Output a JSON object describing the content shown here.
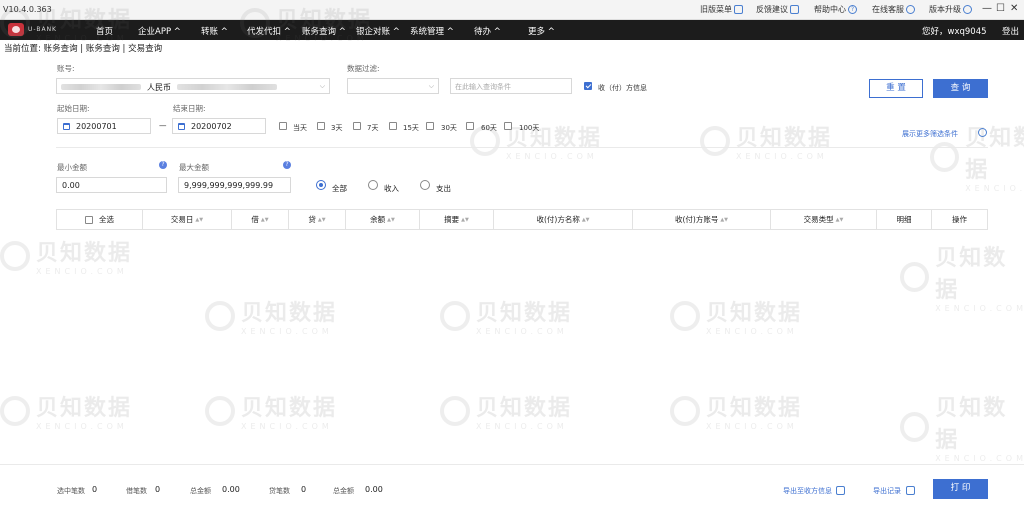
{
  "titlebar": {
    "version": "V10.4.0.363",
    "items": [
      {
        "label": "旧版菜单"
      },
      {
        "label": "反馈建议"
      },
      {
        "label": "帮助中心"
      },
      {
        "label": "在线客服"
      },
      {
        "label": "版本升级"
      }
    ],
    "minimize": "—",
    "maximize": "☐",
    "close": "✕"
  },
  "navbar": {
    "logo_text": "U-BANK",
    "items": [
      "首页",
      "企业APP ^",
      "转账 ^",
      "代发代扣 ^",
      "账务查询 ^",
      "银企对账 ^",
      "系统管理 ^",
      "待办 ^",
      "更多 ^"
    ],
    "greeting": "您好，wxq9045",
    "logout": "登出"
  },
  "breadcrumb": "当前位置: 账务查询 | 账务查询 | 交易查询",
  "filters": {
    "account_label": "账号:",
    "account_currency": "人民币",
    "filter_label": "数据过滤:",
    "filter_placeholder": "在此输入查询条件",
    "counterparty_info_label": "收（付）方信息",
    "start_date_label": "起始日期:",
    "start_date": "20200701",
    "end_date_label": "结束日期:",
    "end_date": "20200702",
    "date_separator": "—",
    "quick_ranges": [
      "当天",
      "3天",
      "7天",
      "15天",
      "30天",
      "60天",
      "100天"
    ],
    "more_filters": "展示更多筛选条件",
    "min_amount_label": "最小金额",
    "min_amount": "0.00",
    "max_amount_label": "最大金额",
    "max_amount": "9,999,999,999,999.99",
    "direction_options": [
      "全部",
      "收入",
      "支出"
    ],
    "direction_selected": "全部",
    "reset_button": "重 置",
    "query_button": "查 询"
  },
  "table": {
    "select_all": "全选",
    "columns": [
      "交易日",
      "借",
      "贷",
      "余额",
      "摘要",
      "收(付)方名称",
      "收(付)方账号",
      "交易类型",
      "明细",
      "操作"
    ],
    "rows": []
  },
  "footer": {
    "selected_count_label": "选中笔数",
    "selected_count": "0",
    "debit_count_label": "借笔数",
    "debit_count": "0",
    "debit_total_label": "总金额",
    "debit_total": "0.00",
    "credit_count_label": "贷笔数",
    "credit_count": "0",
    "credit_total_label": "总金额",
    "credit_total": "0.00",
    "export_counterparty": "导出至收方信息",
    "export_records": "导出记录",
    "print_button": "打 印"
  },
  "watermark": {
    "text": "贝知数据",
    "sub": "XENCIO.COM"
  },
  "colors": {
    "accent": "#3d6fd1",
    "navbar": "#1c1c1c"
  }
}
